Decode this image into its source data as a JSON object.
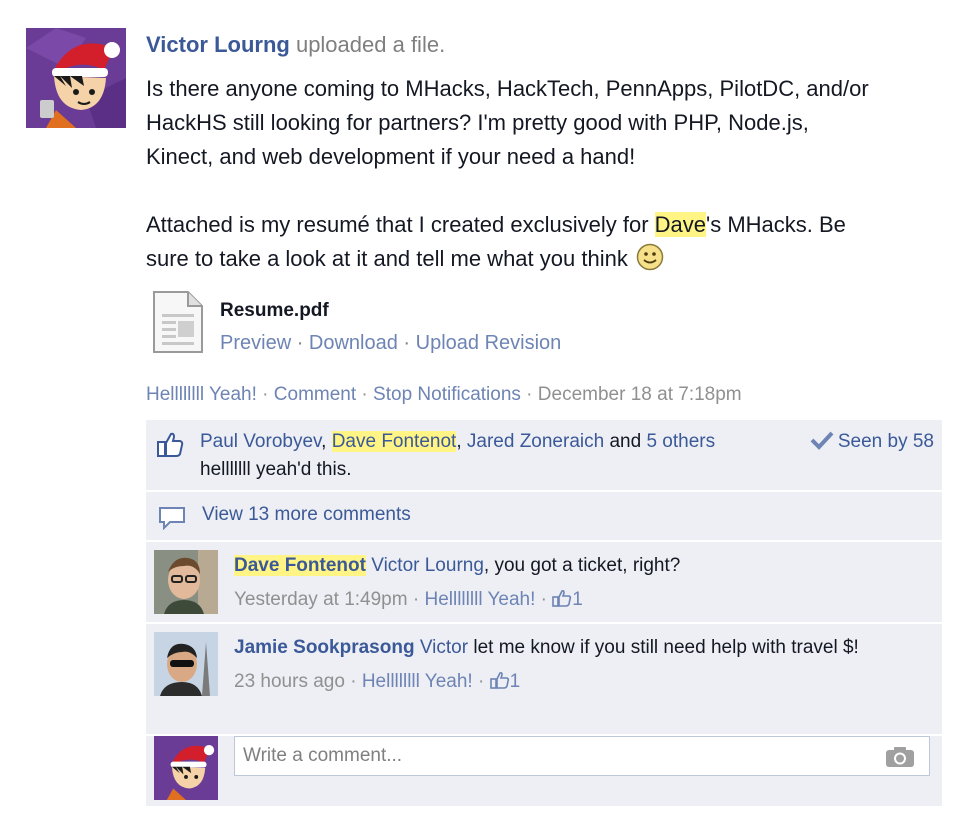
{
  "post": {
    "author": "Victor Lourng",
    "action": "uploaded a file.",
    "text_line1": "Is there anyone coming to MHacks, HackTech, PennApps, PilotDC, and/or",
    "text_line2": "HackHS still looking for partners? I'm pretty good with PHP, Node.js,",
    "text_line3": "Kinect, and web development if your need a hand!",
    "text_line4_pre": "Attached is my resumé that I created exclusively for ",
    "text_line4_hl": "Dave",
    "text_line4_post": "'s MHacks. Be",
    "text_line5": "sure to take a look at it and tell me what you think",
    "file": {
      "name": "Resume.pdf",
      "preview": "Preview",
      "download": "Download",
      "upload_revision": "Upload Revision"
    },
    "actions": {
      "like": "Hellllllll Yeah!",
      "comment": "Comment",
      "stop_notifications": "Stop Notifications",
      "timestamp": "December 18 at 7:18pm"
    }
  },
  "likes": {
    "person1": "Paul Vorobyev",
    "person2": "Dave Fontenot",
    "person3": "Jared Zoneraich",
    "and": "and",
    "others": "5 others",
    "suffix": "helllllll yeah'd this.",
    "seen": "Seen by 58"
  },
  "view_more": "View 13 more comments",
  "comments": [
    {
      "author": "Dave Fontenot",
      "mention": "Victor Lourng",
      "text": ", you got a ticket, right?",
      "time": "Yesterday at 1:49pm",
      "like_label": "Hellllllll Yeah!",
      "likes": "1"
    },
    {
      "author": "Jamie Sookprasong",
      "mention": "Victor",
      "text": " let me know if you still need help with travel $!",
      "time": "23 hours ago",
      "like_label": "Hellllllll Yeah!",
      "likes": "1"
    }
  ],
  "write_comment": {
    "placeholder": "Write a comment..."
  },
  "colors": {
    "link": "#3b5998",
    "ufi_bg": "#edeff4",
    "highlight": "#fff484"
  }
}
